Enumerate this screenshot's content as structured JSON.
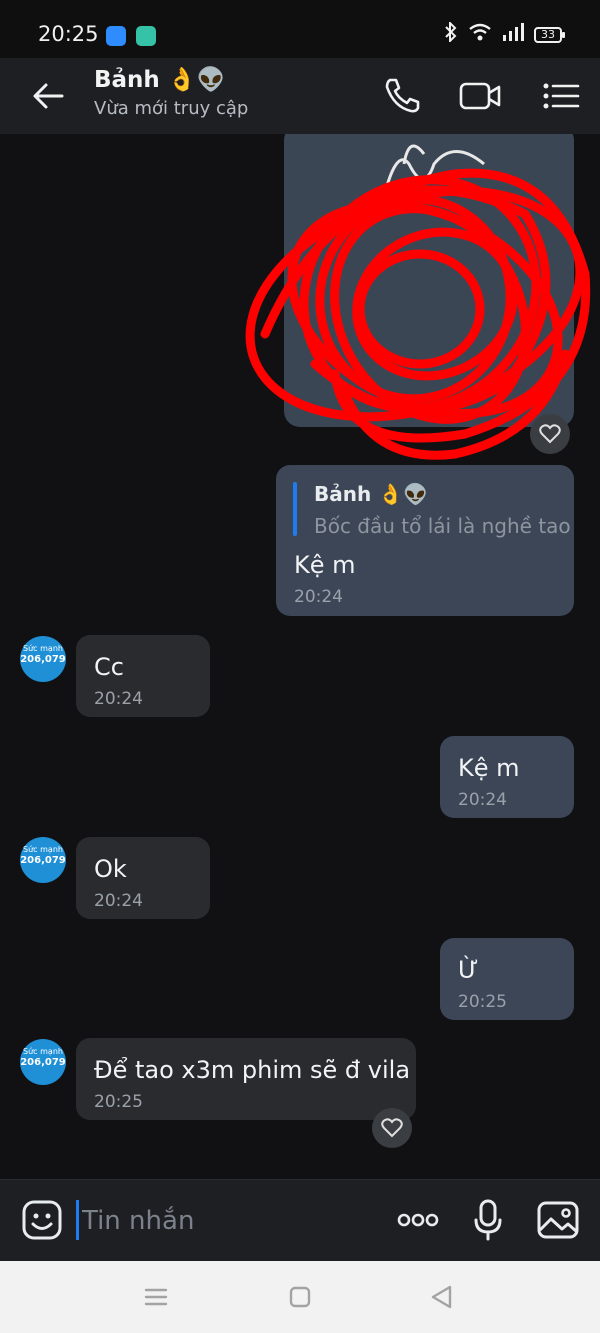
{
  "status_bar": {
    "time": "20:25",
    "battery": "33"
  },
  "header": {
    "name": "Bảnh 👌👽",
    "status": "Vừa mới truy cập"
  },
  "messages": {
    "reply": {
      "quote_name": "Bảnh 👌👽",
      "quote_text": "Bốc đầu tổ lái là nghề tao",
      "text": "Kệ m",
      "time": "20:24"
    },
    "m1": {
      "text": "Cc",
      "time": "20:24"
    },
    "m2": {
      "text": "Kệ m",
      "time": "20:24"
    },
    "m3": {
      "text": "Ok",
      "time": "20:24"
    },
    "m4": {
      "text": "Ừ",
      "time": "20:25"
    },
    "m5": {
      "text": "Để tao x3m phim sẽ đ vila",
      "time": "20:25"
    }
  },
  "avatar": {
    "line1": "Sức mạnh",
    "line2": "206,079"
  },
  "input": {
    "placeholder": "Tin nhắn"
  },
  "colors": {
    "accent": "#1f7cf0",
    "outgoing_bubble": "#3c4656",
    "incoming_bubble": "#2a2b2e",
    "scribble": "#ff0000"
  }
}
